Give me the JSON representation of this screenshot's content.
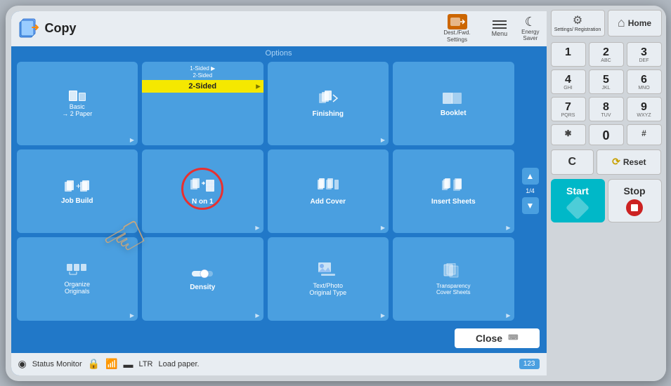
{
  "app": {
    "title": "Copy"
  },
  "topbar": {
    "copy_label": "Copy",
    "dest_fwd_label": "Dest./Fwd.\nSettings",
    "menu_label": "Menu",
    "energy_saver_label": "Energy Saver"
  },
  "options_section": {
    "label": "Options"
  },
  "options": [
    {
      "id": "basic-2-paper",
      "label": "Basic\n→ 2 Paper",
      "row": 1,
      "col": 1,
      "has_arrow": false,
      "sub_label": ""
    },
    {
      "id": "2-sided",
      "label": "2-Sided",
      "row": 1,
      "col": 2,
      "has_arrow": true,
      "top_text": "1-Sided ▶\n2-Sided",
      "active_yellow": true
    },
    {
      "id": "finishing",
      "label": "Finishing",
      "row": 1,
      "col": 3,
      "has_arrow": true
    },
    {
      "id": "booklet",
      "label": "Booklet",
      "row": 1,
      "col": 4,
      "has_arrow": false
    },
    {
      "id": "job-build",
      "label": "Job Build",
      "row": 2,
      "col": 1,
      "has_arrow": false
    },
    {
      "id": "n-on-1",
      "label": "N on 1",
      "row": 2,
      "col": 2,
      "has_arrow": true,
      "circled": true
    },
    {
      "id": "add-cover",
      "label": "Add Cover",
      "row": 2,
      "col": 3,
      "has_arrow": true
    },
    {
      "id": "insert-sheets",
      "label": "Insert Sheets",
      "row": 2,
      "col": 4,
      "has_arrow": true
    },
    {
      "id": "organize-originals",
      "label": "Organize\nOriginals",
      "row": 3,
      "col": 1,
      "has_arrow": true
    },
    {
      "id": "density",
      "label": "Density",
      "row": 3,
      "col": 2,
      "has_arrow": true
    },
    {
      "id": "text-photo",
      "label": "Text/Photo\nOriginal Type",
      "row": 3,
      "col": 3,
      "has_arrow": true
    },
    {
      "id": "transparency-cover",
      "label": "Transparency\nCover Sheets",
      "row": 3,
      "col": 4,
      "has_arrow": true
    }
  ],
  "scroll": {
    "page_indicator": "1/4"
  },
  "bottom": {
    "close_label": "Close"
  },
  "status_bar": {
    "monitor_label": "Status Monitor",
    "paper_label": "Load paper.",
    "paper_size": "LTR"
  },
  "numpad": {
    "keys": [
      {
        "label": "1",
        "sub": ""
      },
      {
        "label": "2",
        "sub": "ABC"
      },
      {
        "label": "3",
        "sub": "DEF"
      },
      {
        "label": "4",
        "sub": "GHI"
      },
      {
        "label": "5",
        "sub": "JKL"
      },
      {
        "label": "6",
        "sub": "MNO"
      },
      {
        "label": "7",
        "sub": "PQRS"
      },
      {
        "label": "8",
        "sub": "TUV"
      },
      {
        "label": "9",
        "sub": "WXYZ"
      },
      {
        "label": "✱",
        "sub": ""
      },
      {
        "label": "0",
        "sub": ""
      },
      {
        "label": "#",
        "sub": ""
      }
    ],
    "c_label": "C",
    "reset_label": "Reset",
    "start_label": "Start",
    "stop_label": "Stop",
    "settings_label": "Settings/\nRegistration",
    "home_label": "Home"
  },
  "colors": {
    "screen_bg": "#2178c8",
    "btn_bg": "#4a9fe0",
    "active_yellow": "#f5e800",
    "start_color": "#00b8c8",
    "stop_circle": "#cc2222"
  }
}
